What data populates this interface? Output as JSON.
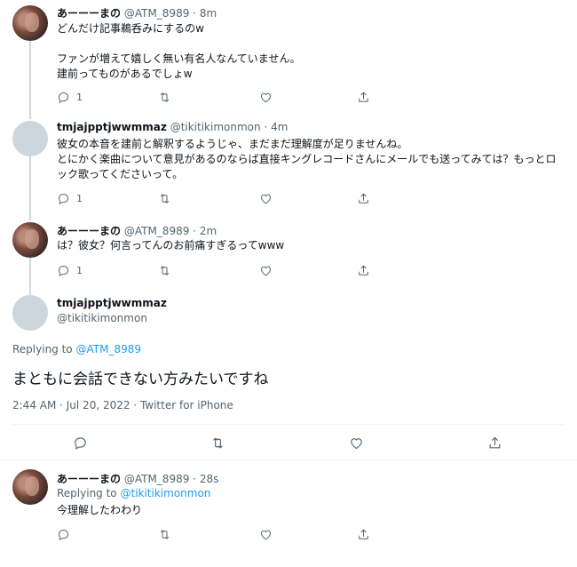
{
  "tweets": [
    {
      "name": "あーーーまの",
      "handle": "@ATM_8989",
      "dot": "·",
      "time": "8m",
      "text": "どんだけ記事鵜呑みにするのw\n\nファンが増えて嬉しく無い有名人なんていません。\n建前ってものがあるでしょw",
      "reply_count": "1"
    },
    {
      "name": "tmjajpptjwwmmaz",
      "handle": "@tikitikimonmon",
      "dot": "·",
      "time": "4m",
      "text": "彼女の本音を建前と解釈するようじゃ、まだまだ理解度が足りませんね。\nとにかく楽曲について意見があるのならば直接キングレコードさんにメールでも送ってみては？もっとロック歌ってくださいって。",
      "reply_count": "1"
    },
    {
      "name": "あーーーまの",
      "handle": "@ATM_8989",
      "dot": "·",
      "time": "2m",
      "text": "は？彼女？何言ってんのお前痛すぎるってwww",
      "reply_count": "1"
    }
  ],
  "focused": {
    "name": "tmjajpptjwwmmaz",
    "handle": "@tikitikimonmon",
    "replying_prefix": "Replying to",
    "replying_to": "@ATM_8989",
    "text": "まともに会話できない方みたいですね",
    "meta": "2:44 AM · Jul 20, 2022 · Twitter for iPhone"
  },
  "reply": {
    "name": "あーーーまの",
    "handle": "@ATM_8989",
    "dot": "·",
    "time": "28s",
    "replying_prefix": "Replying to",
    "replying_to": "@tikitikimonmon",
    "text": "今理解したわわり"
  },
  "icons": [
    "reply-icon",
    "retweet-icon",
    "like-icon",
    "share-icon"
  ],
  "colors": {
    "link": "#1d9bf0",
    "secondary": "#536471",
    "line": "#cfd9de"
  }
}
